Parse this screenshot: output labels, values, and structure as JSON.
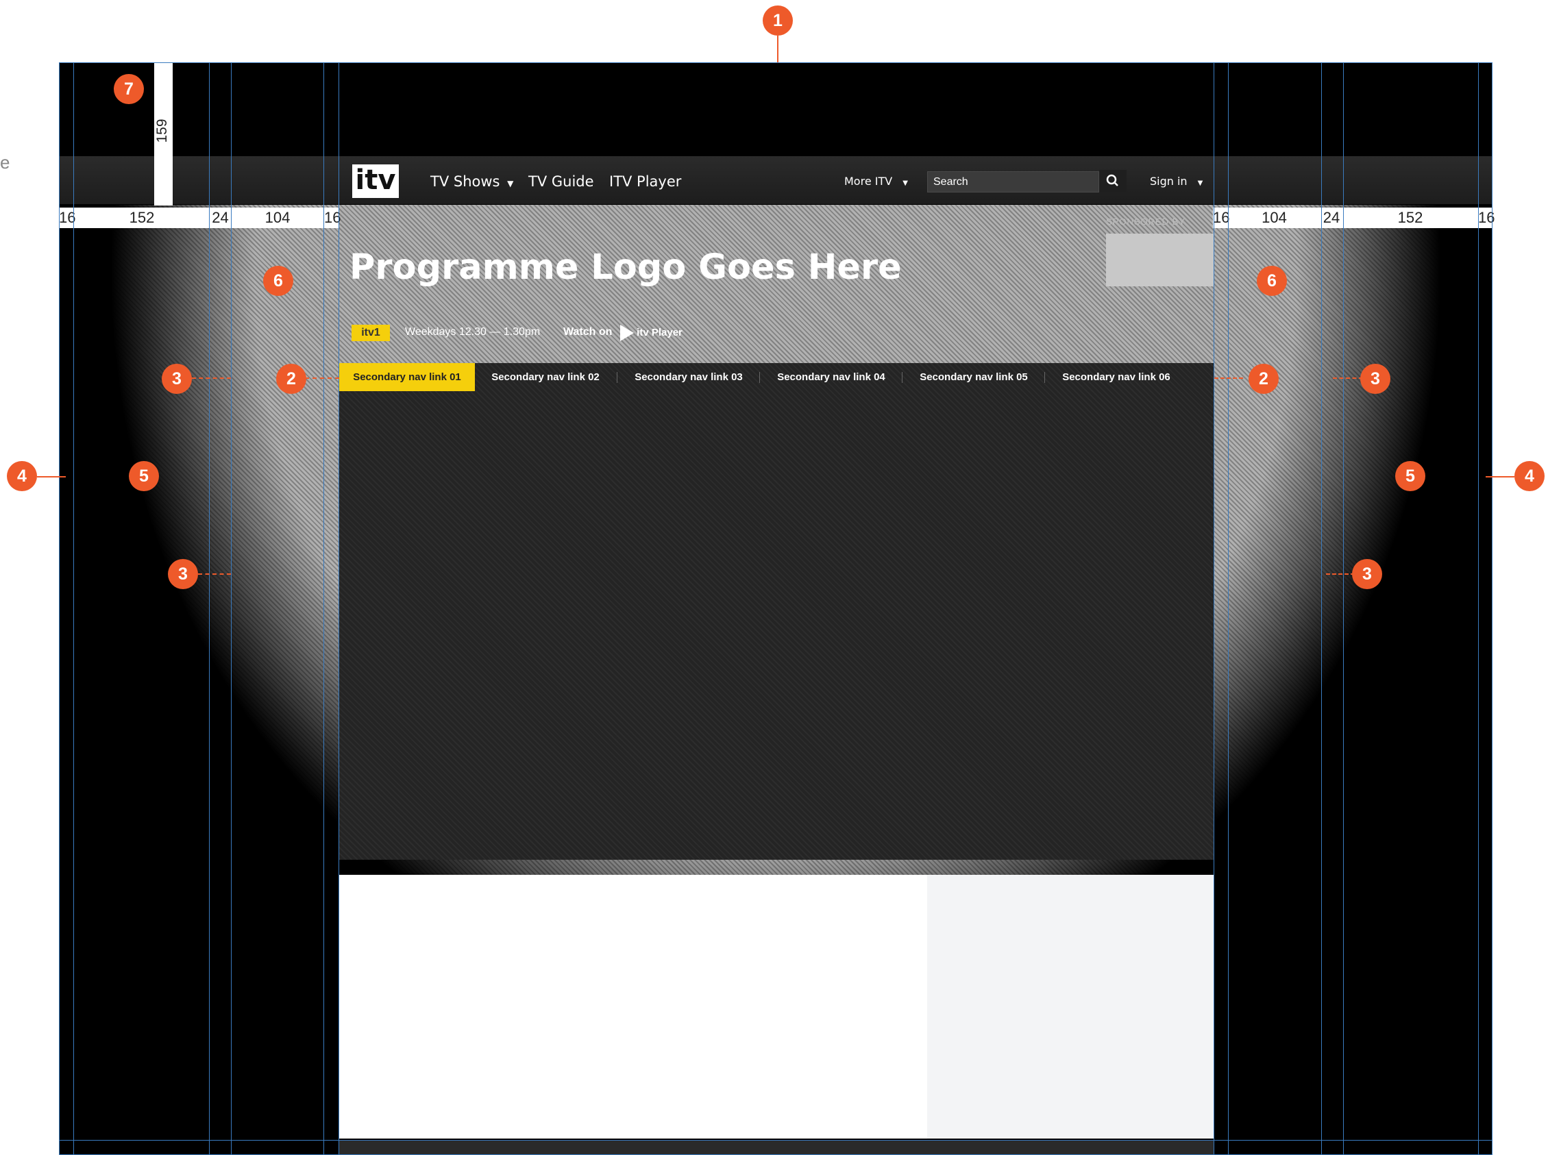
{
  "header": {
    "logo": "itv",
    "nav": [
      "TV Shows",
      "TV Guide",
      "ITV Player"
    ],
    "more": "More ITV",
    "search_placeholder": "Search",
    "signin": "Sign in"
  },
  "programme": {
    "title": "Programme Logo Goes Here",
    "sponsored_by": "SPONSORED BY",
    "channel_logo": "itv1",
    "schedule": "Weekdays 12.30 — 1.30pm",
    "watch_on": "Watch on",
    "player_logo": "itv Player"
  },
  "secondary_nav": [
    "Secondary nav link 01",
    "Secondary nav link 02",
    "Secondary nav link 03",
    "Secondary nav link 04",
    "Secondary nav link 05",
    "Secondary nav link 06"
  ],
  "ruler": {
    "left": [
      "16",
      "152",
      "24",
      "104",
      "16"
    ],
    "right": [
      "16",
      "104",
      "24",
      "152",
      "16"
    ],
    "vertical": "159"
  },
  "annotations": [
    "1",
    "2",
    "2",
    "3",
    "3",
    "3",
    "3",
    "4",
    "4",
    "5",
    "5",
    "6",
    "6",
    "7"
  ],
  "colors": {
    "accent": "#f5cf0c",
    "marker": "#ee5a2a",
    "guide": "#3a7bbf"
  },
  "icons": {
    "search": "search-icon",
    "dropdown": "chevron-down-icon"
  }
}
